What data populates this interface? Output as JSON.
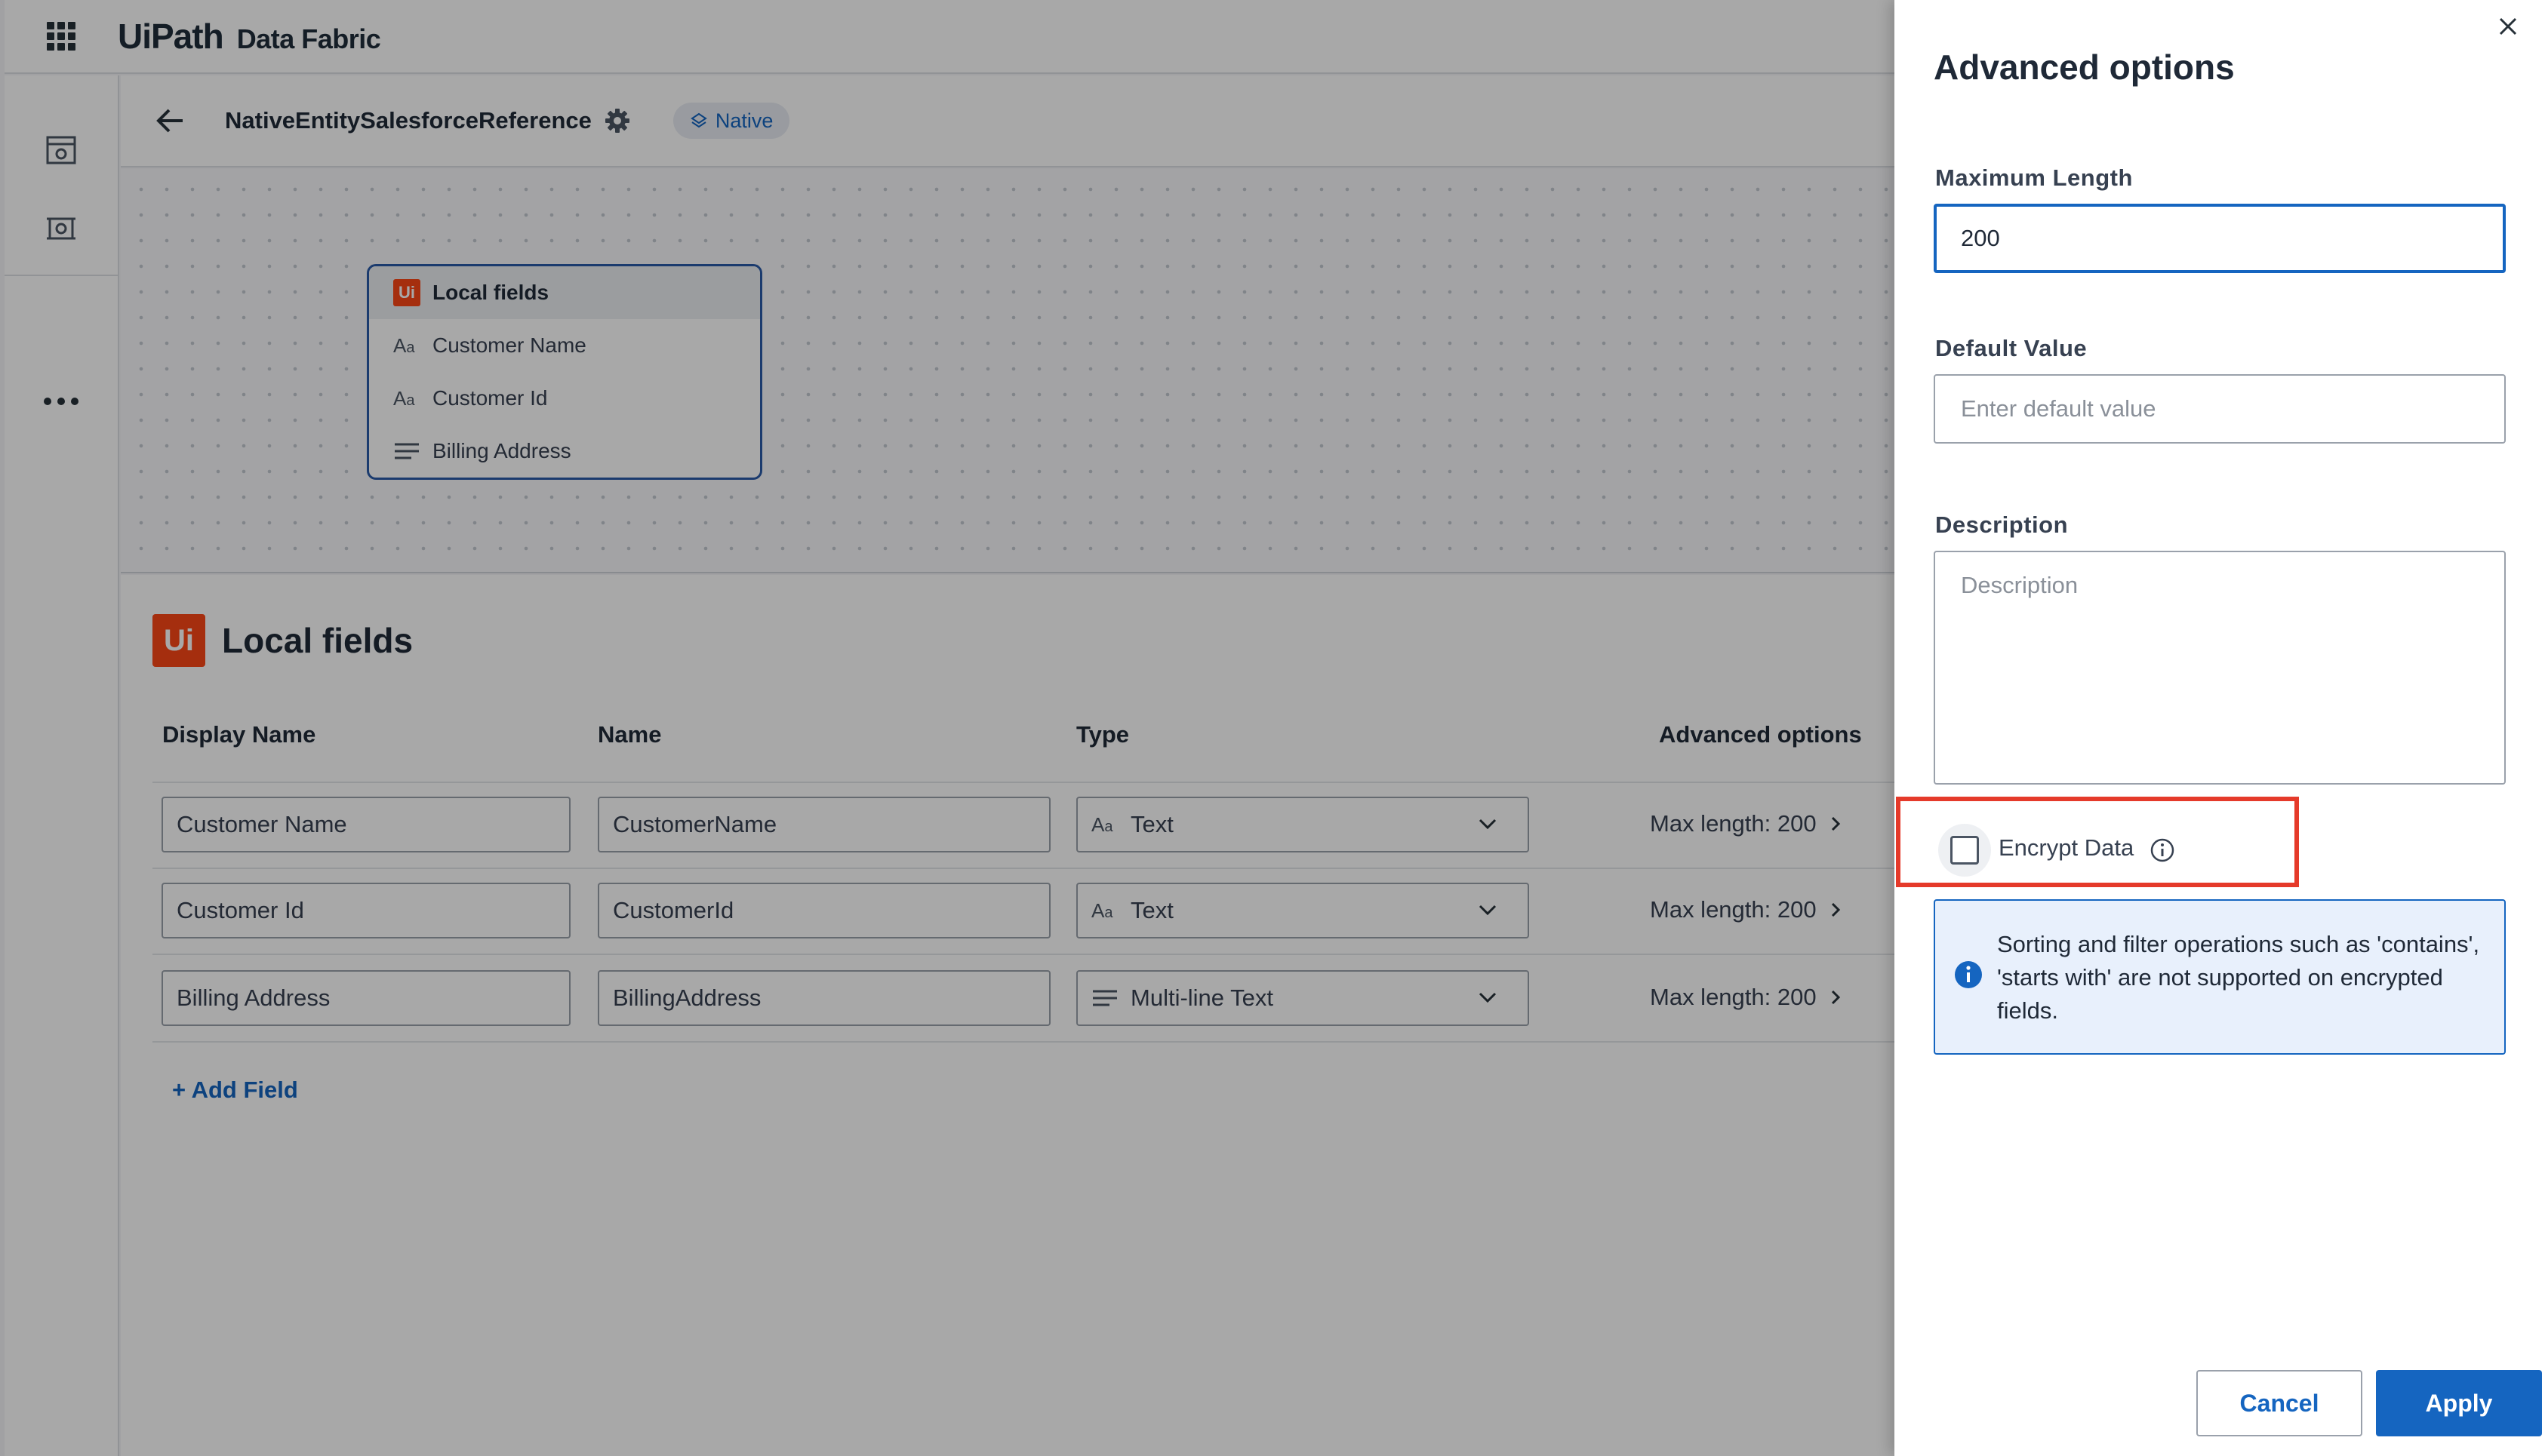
{
  "topbar": {
    "brand_ui": "UiPath",
    "product": "Data Fabric"
  },
  "header": {
    "entity_name": "NativeEntitySalesforceReference",
    "native_badge": "Native"
  },
  "canvas_node": {
    "title": "Local fields",
    "fields": [
      {
        "type_icon": "text-type-icon",
        "label": "Customer Name"
      },
      {
        "type_icon": "text-type-icon",
        "label": "Customer Id"
      },
      {
        "type_icon": "multiline-text-type-icon",
        "label": "Billing Address"
      }
    ]
  },
  "local_fields": {
    "title": "Local fields",
    "logo_text": "Ui",
    "columns": {
      "display_name": "Display Name",
      "name": "Name",
      "type": "Type",
      "advanced": "Advanced options"
    },
    "rows": [
      {
        "display_name": "Customer Name",
        "name": "CustomerName",
        "type": "Text",
        "advanced": "Max length: 200"
      },
      {
        "display_name": "Customer Id",
        "name": "CustomerId",
        "type": "Text",
        "advanced": "Max length: 200"
      },
      {
        "display_name": "Billing Address",
        "name": "BillingAddress",
        "type": "Multi-line Text",
        "advanced": "Max length: 200"
      }
    ],
    "add_field": "+ Add Field"
  },
  "drawer": {
    "title": "Advanced options",
    "max_length_label": "Maximum Length",
    "max_length_value": "200",
    "default_value_label": "Default Value",
    "default_value_placeholder": "Enter default value",
    "description_label": "Description",
    "description_placeholder": "Description",
    "encrypt_label": "Encrypt Data",
    "encrypt_checked": false,
    "info_text": "Sorting and filter operations such as 'contains', 'starts with' are not supported on encrypted fields.",
    "cancel": "Cancel",
    "apply": "Apply"
  },
  "colors": {
    "brand_orange": "#fa4616",
    "primary_blue": "#1565c0",
    "highlight_red": "#e53a2a",
    "info_bg": "#e8f0fc"
  }
}
